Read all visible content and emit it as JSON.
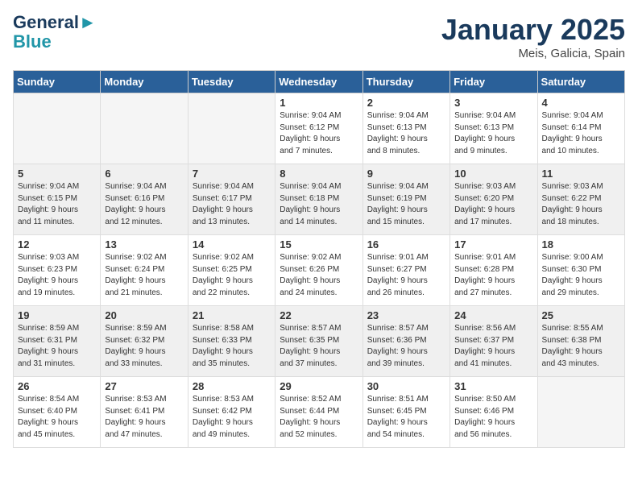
{
  "logo": {
    "line1": "General",
    "line2": "Blue"
  },
  "title": "January 2025",
  "location": "Meis, Galicia, Spain",
  "days_of_week": [
    "Sunday",
    "Monday",
    "Tuesday",
    "Wednesday",
    "Thursday",
    "Friday",
    "Saturday"
  ],
  "weeks": [
    [
      {
        "day": "",
        "info": "",
        "empty": true
      },
      {
        "day": "",
        "info": "",
        "empty": true
      },
      {
        "day": "",
        "info": "",
        "empty": true
      },
      {
        "day": "1",
        "info": "Sunrise: 9:04 AM\nSunset: 6:12 PM\nDaylight: 9 hours\nand 7 minutes.",
        "empty": false
      },
      {
        "day": "2",
        "info": "Sunrise: 9:04 AM\nSunset: 6:13 PM\nDaylight: 9 hours\nand 8 minutes.",
        "empty": false
      },
      {
        "day": "3",
        "info": "Sunrise: 9:04 AM\nSunset: 6:13 PM\nDaylight: 9 hours\nand 9 minutes.",
        "empty": false
      },
      {
        "day": "4",
        "info": "Sunrise: 9:04 AM\nSunset: 6:14 PM\nDaylight: 9 hours\nand 10 minutes.",
        "empty": false
      }
    ],
    [
      {
        "day": "5",
        "info": "Sunrise: 9:04 AM\nSunset: 6:15 PM\nDaylight: 9 hours\nand 11 minutes.",
        "empty": false
      },
      {
        "day": "6",
        "info": "Sunrise: 9:04 AM\nSunset: 6:16 PM\nDaylight: 9 hours\nand 12 minutes.",
        "empty": false
      },
      {
        "day": "7",
        "info": "Sunrise: 9:04 AM\nSunset: 6:17 PM\nDaylight: 9 hours\nand 13 minutes.",
        "empty": false
      },
      {
        "day": "8",
        "info": "Sunrise: 9:04 AM\nSunset: 6:18 PM\nDaylight: 9 hours\nand 14 minutes.",
        "empty": false
      },
      {
        "day": "9",
        "info": "Sunrise: 9:04 AM\nSunset: 6:19 PM\nDaylight: 9 hours\nand 15 minutes.",
        "empty": false
      },
      {
        "day": "10",
        "info": "Sunrise: 9:03 AM\nSunset: 6:20 PM\nDaylight: 9 hours\nand 17 minutes.",
        "empty": false
      },
      {
        "day": "11",
        "info": "Sunrise: 9:03 AM\nSunset: 6:22 PM\nDaylight: 9 hours\nand 18 minutes.",
        "empty": false
      }
    ],
    [
      {
        "day": "12",
        "info": "Sunrise: 9:03 AM\nSunset: 6:23 PM\nDaylight: 9 hours\nand 19 minutes.",
        "empty": false
      },
      {
        "day": "13",
        "info": "Sunrise: 9:02 AM\nSunset: 6:24 PM\nDaylight: 9 hours\nand 21 minutes.",
        "empty": false
      },
      {
        "day": "14",
        "info": "Sunrise: 9:02 AM\nSunset: 6:25 PM\nDaylight: 9 hours\nand 22 minutes.",
        "empty": false
      },
      {
        "day": "15",
        "info": "Sunrise: 9:02 AM\nSunset: 6:26 PM\nDaylight: 9 hours\nand 24 minutes.",
        "empty": false
      },
      {
        "day": "16",
        "info": "Sunrise: 9:01 AM\nSunset: 6:27 PM\nDaylight: 9 hours\nand 26 minutes.",
        "empty": false
      },
      {
        "day": "17",
        "info": "Sunrise: 9:01 AM\nSunset: 6:28 PM\nDaylight: 9 hours\nand 27 minutes.",
        "empty": false
      },
      {
        "day": "18",
        "info": "Sunrise: 9:00 AM\nSunset: 6:30 PM\nDaylight: 9 hours\nand 29 minutes.",
        "empty": false
      }
    ],
    [
      {
        "day": "19",
        "info": "Sunrise: 8:59 AM\nSunset: 6:31 PM\nDaylight: 9 hours\nand 31 minutes.",
        "empty": false
      },
      {
        "day": "20",
        "info": "Sunrise: 8:59 AM\nSunset: 6:32 PM\nDaylight: 9 hours\nand 33 minutes.",
        "empty": false
      },
      {
        "day": "21",
        "info": "Sunrise: 8:58 AM\nSunset: 6:33 PM\nDaylight: 9 hours\nand 35 minutes.",
        "empty": false
      },
      {
        "day": "22",
        "info": "Sunrise: 8:57 AM\nSunset: 6:35 PM\nDaylight: 9 hours\nand 37 minutes.",
        "empty": false
      },
      {
        "day": "23",
        "info": "Sunrise: 8:57 AM\nSunset: 6:36 PM\nDaylight: 9 hours\nand 39 minutes.",
        "empty": false
      },
      {
        "day": "24",
        "info": "Sunrise: 8:56 AM\nSunset: 6:37 PM\nDaylight: 9 hours\nand 41 minutes.",
        "empty": false
      },
      {
        "day": "25",
        "info": "Sunrise: 8:55 AM\nSunset: 6:38 PM\nDaylight: 9 hours\nand 43 minutes.",
        "empty": false
      }
    ],
    [
      {
        "day": "26",
        "info": "Sunrise: 8:54 AM\nSunset: 6:40 PM\nDaylight: 9 hours\nand 45 minutes.",
        "empty": false
      },
      {
        "day": "27",
        "info": "Sunrise: 8:53 AM\nSunset: 6:41 PM\nDaylight: 9 hours\nand 47 minutes.",
        "empty": false
      },
      {
        "day": "28",
        "info": "Sunrise: 8:53 AM\nSunset: 6:42 PM\nDaylight: 9 hours\nand 49 minutes.",
        "empty": false
      },
      {
        "day": "29",
        "info": "Sunrise: 8:52 AM\nSunset: 6:44 PM\nDaylight: 9 hours\nand 52 minutes.",
        "empty": false
      },
      {
        "day": "30",
        "info": "Sunrise: 8:51 AM\nSunset: 6:45 PM\nDaylight: 9 hours\nand 54 minutes.",
        "empty": false
      },
      {
        "day": "31",
        "info": "Sunrise: 8:50 AM\nSunset: 6:46 PM\nDaylight: 9 hours\nand 56 minutes.",
        "empty": false
      },
      {
        "day": "",
        "info": "",
        "empty": true
      }
    ]
  ]
}
